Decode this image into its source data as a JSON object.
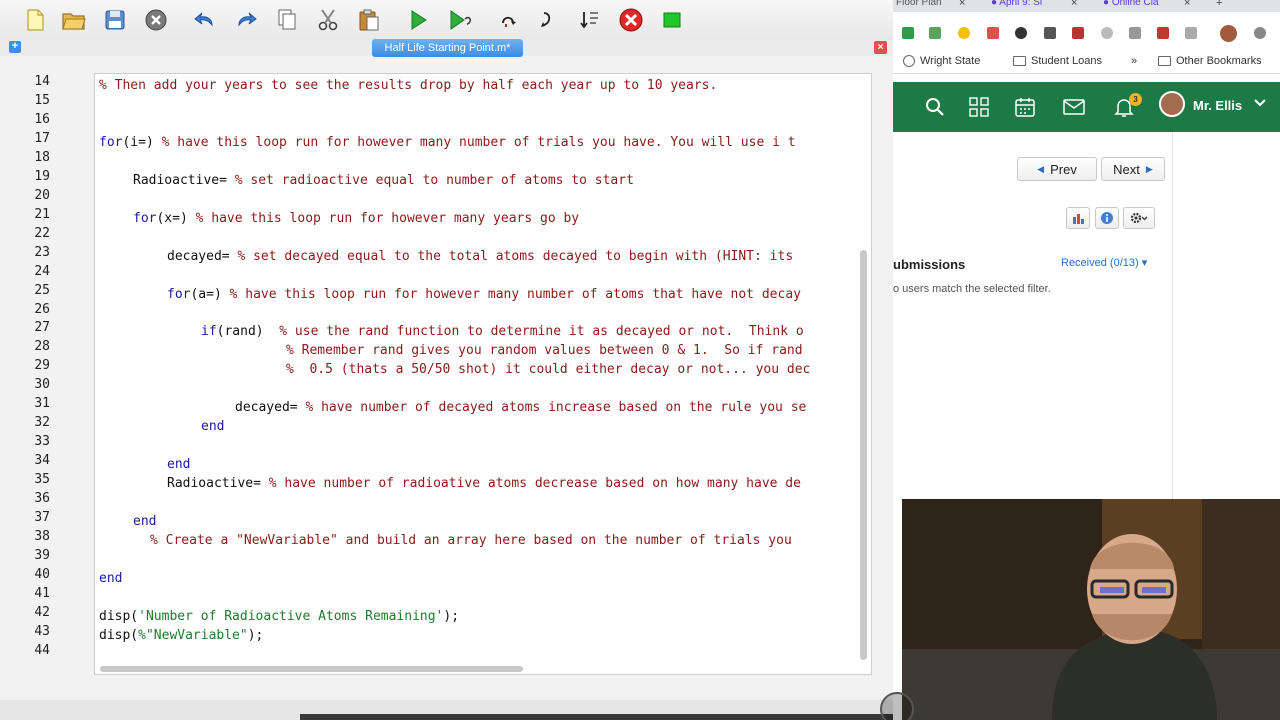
{
  "editor": {
    "document_tab": "Half Life Starting Point.m*",
    "line_numbers": [
      "14",
      "15",
      "16",
      "17",
      "18",
      "19",
      "20",
      "21",
      "22",
      "23",
      "24",
      "25",
      "26",
      "27",
      "28",
      "29",
      "30",
      "31",
      "32",
      "33",
      "34",
      "35",
      "36",
      "37",
      "38",
      "39",
      "40",
      "41",
      "42",
      "43",
      "44"
    ],
    "code": {
      "l14": "% Then add your years to see the results drop by half each year up to 10 years.",
      "l17_kw": "for",
      "l17_code": "(i=) ",
      "l17_cm": "% have this loop run for however many number of trials you have. You will use i t",
      "l19_code": "Radioactive= ",
      "l19_cm": "% set radioactive equal to number of atoms to start",
      "l21_kw": "for",
      "l21_code": "(x=) ",
      "l21_cm": "% have this loop run for however many years go by",
      "l23_code": "decayed= ",
      "l23_cm": "% set decayed equal to the total atoms decayed to begin with (HINT: its",
      "l25_kw": "for",
      "l25_code": "(a=) ",
      "l25_cm": "% have this loop run for however many number of atoms that have not decay",
      "l27_kw": "if",
      "l27_code": "(rand)  ",
      "l27_cm": "% use the rand function to determine it as decayed or not.  Think o",
      "l28_cm": "% Remember rand gives you random values between 0 & 1.  So if rand",
      "l29_cm": "%  0.5 (thats a 50/50 shot) it could either decay or not... you dec",
      "l31_code": "decayed= ",
      "l31_cm": "% have number of decayed atoms increase based on the rule you se",
      "l32_kw": "end",
      "l34_kw": "end",
      "l35_code": "Radioactive= ",
      "l35_cm": "% have number of radioative atoms decrease based on how many have de",
      "l37_kw": "end",
      "l38_cm": "% Create a \"NewVariable\" and build an array here based on the number of trials you",
      "l40_kw": "end",
      "l42_code_a": "disp(",
      "l42_str": "'Number of Radioactive Atoms Remaining'",
      "l42_code_b": ");",
      "l43_code_a": "disp(",
      "l43_str": "%\"NewVariable\"",
      "l43_code_b": ");"
    }
  },
  "browser": {
    "tabs": [
      "Floor Plan",
      "April 9: Si",
      "Online Cla"
    ],
    "bookmarks": [
      "Wright State",
      "Student Loans",
      "Other Bookmarks"
    ],
    "bookmarks_more": "»",
    "notification_count": "3",
    "user_name": "Mr. Ellis",
    "nav": {
      "prev": "Prev",
      "next": "Next"
    },
    "submissions_title": "ubmissions",
    "received_filter": "Received (0/13)",
    "empty_message": "o users match the selected filter.",
    "colors": {
      "appbar": "#1d7a46",
      "link": "#2b6cc4",
      "badge": "#f3b21f"
    }
  }
}
